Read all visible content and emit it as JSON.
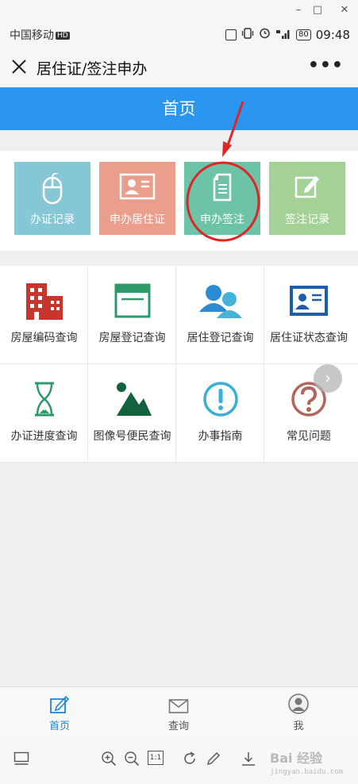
{
  "window": {
    "minimize": "–",
    "maximize": "□",
    "close": "✕"
  },
  "status_bar": {
    "carrier": "中国移动",
    "hd": "HD",
    "battery": "80",
    "time": "09:48"
  },
  "title_bar": {
    "title": "居住证/签注申办",
    "more": "•••"
  },
  "header": {
    "title": "首页"
  },
  "quick_actions": [
    {
      "label": "办证记录",
      "icon": "mouse-icon",
      "color": "#86c7d6"
    },
    {
      "label": "申办居住证",
      "icon": "id-card-icon",
      "color": "#ec9e8c"
    },
    {
      "label": "申办签注",
      "icon": "document-icon",
      "color": "#6cc3a8"
    },
    {
      "label": "签注记录",
      "icon": "edit-icon",
      "color": "#a4d296"
    }
  ],
  "services": [
    {
      "label": "房屋编码查询",
      "icon": "building-icon"
    },
    {
      "label": "房屋登记查询",
      "icon": "window-icon"
    },
    {
      "label": "居住登记查询",
      "icon": "people-icon"
    },
    {
      "label": "居住证状态查询",
      "icon": "id-card-icon"
    },
    {
      "label": "办证进度查询",
      "icon": "hourglass-icon"
    },
    {
      "label": "图像号便民查询",
      "icon": "image-icon"
    },
    {
      "label": "办事指南",
      "icon": "exclamation-icon"
    },
    {
      "label": "常见问题",
      "icon": "question-icon"
    }
  ],
  "scroll_arrow": "›",
  "tabs": [
    {
      "label": "首页",
      "icon": "edit-icon",
      "active": true,
      "color": "#1f87d6"
    },
    {
      "label": "查询",
      "icon": "mail-icon",
      "active": false,
      "color": "#555555"
    },
    {
      "label": "我",
      "icon": "user-icon",
      "active": false,
      "color": "#555555"
    }
  ],
  "viewer_toolbar": {
    "actual_size": "1:1"
  },
  "watermark": {
    "brand": "Bai 经验",
    "url": "jingyan.baidu.com"
  },
  "colors": {
    "header_blue": "#2b96f0",
    "annotation_red": "#e02525"
  }
}
